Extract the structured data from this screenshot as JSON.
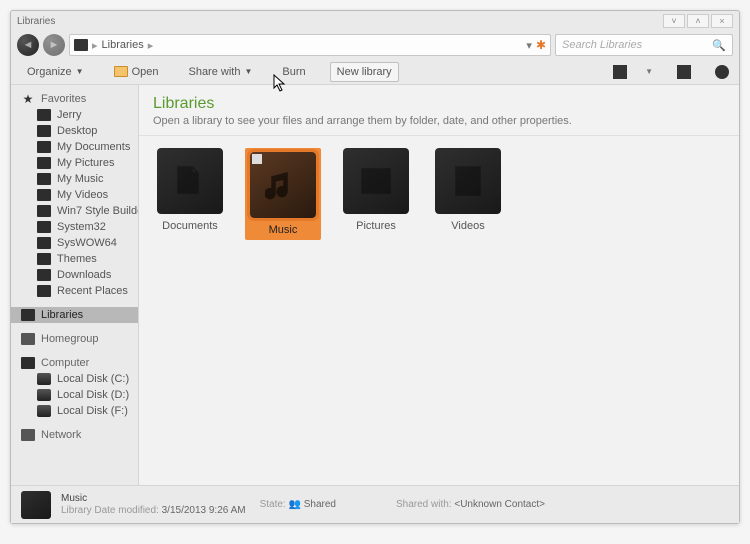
{
  "window": {
    "title": "Libraries"
  },
  "nav": {
    "crumbs": [
      "Libraries"
    ],
    "search_placeholder": "Search Libraries"
  },
  "toolbar": {
    "organize": "Organize",
    "open": "Open",
    "share": "Share with",
    "burn": "Burn",
    "newlib": "New library"
  },
  "sidebar": {
    "favorites": {
      "label": "Favorites",
      "items": [
        "Jerry",
        "Desktop",
        "My Documents",
        "My Pictures",
        "My Music",
        "My Videos",
        "Win7 Style Builde",
        "System32",
        "SysWOW64",
        "Themes",
        "Downloads",
        "Recent Places"
      ]
    },
    "libraries": {
      "label": "Libraries"
    },
    "homegroup": {
      "label": "Homegroup"
    },
    "computer": {
      "label": "Computer",
      "items": [
        "Local Disk (C:)",
        "Local Disk (D:)",
        "Local Disk (F:)"
      ]
    },
    "network": {
      "label": "Network"
    }
  },
  "content": {
    "title": "Libraries",
    "subtitle": "Open a library to see your files and arrange them by folder, date, and other properties.",
    "items": [
      {
        "name": "Documents",
        "icon": "doc",
        "selected": false
      },
      {
        "name": "Music",
        "icon": "music",
        "selected": true
      },
      {
        "name": "Pictures",
        "icon": "pic",
        "selected": false
      },
      {
        "name": "Videos",
        "icon": "vid",
        "selected": false
      }
    ]
  },
  "status": {
    "name": "Music",
    "state_label": "State:",
    "state_value": "Shared",
    "modified_label": "Library Date modified:",
    "modified_value": "3/15/2013 9:26 AM",
    "sharedwith_label": "Shared with:",
    "sharedwith_value": "<Unknown Contact>"
  }
}
